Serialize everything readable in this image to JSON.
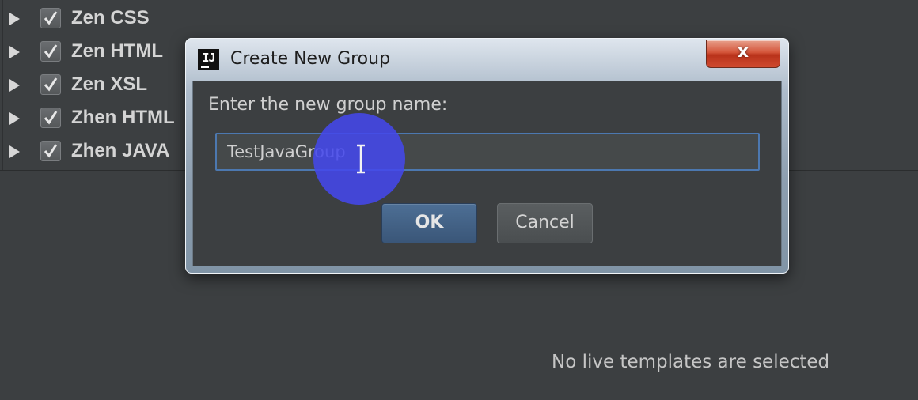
{
  "tree": {
    "groups": [
      {
        "label": "Zen CSS",
        "checked": true
      },
      {
        "label": "Zen HTML",
        "checked": true
      },
      {
        "label": "Zen XSL",
        "checked": true
      },
      {
        "label": "Zhen HTML",
        "checked": true
      },
      {
        "label": "Zhen JAVA",
        "checked": true
      }
    ]
  },
  "empty_message": "No live templates are selected",
  "dialog": {
    "app_icon_text": "IJ",
    "title": "Create New Group",
    "close_label": "x",
    "prompt": "Enter the new group name:",
    "input_value": "TestJavaGroup",
    "ok_label": "OK",
    "cancel_label": "Cancel"
  },
  "colors": {
    "background": "#3c3f41",
    "input_border": "#4c78b0",
    "cursor_highlight": "#4448eb",
    "close_button": "#c8442b"
  }
}
